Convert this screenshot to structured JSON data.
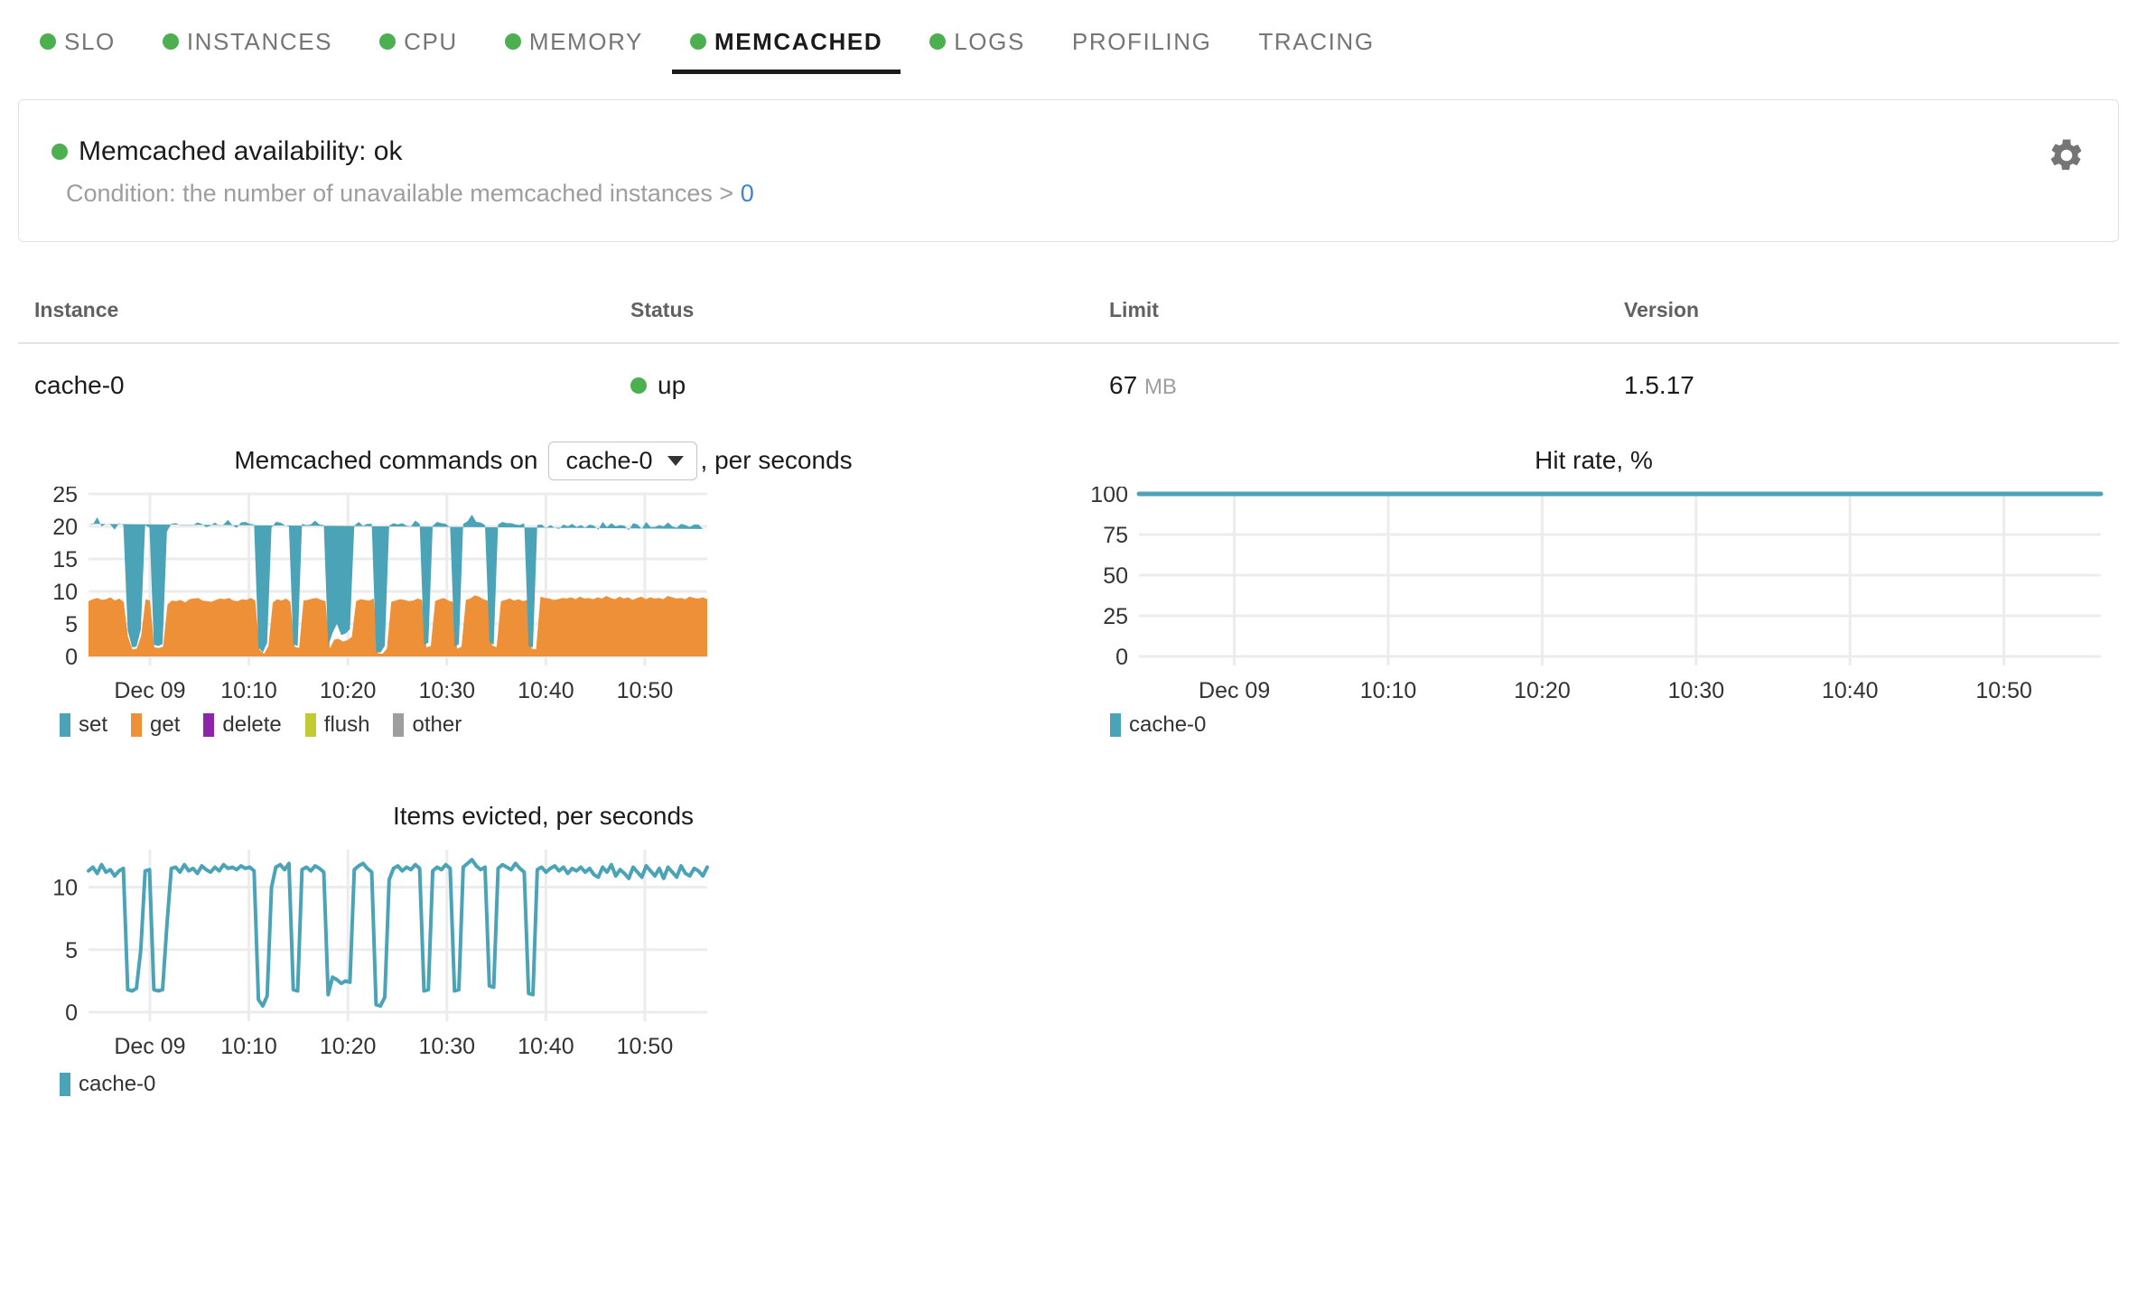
{
  "tabs": [
    {
      "label": "SLO",
      "dot": true,
      "active": false
    },
    {
      "label": "INSTANCES",
      "dot": true,
      "active": false
    },
    {
      "label": "CPU",
      "dot": true,
      "active": false
    },
    {
      "label": "MEMORY",
      "dot": true,
      "active": false
    },
    {
      "label": "MEMCACHED",
      "dot": true,
      "active": true
    },
    {
      "label": "LOGS",
      "dot": true,
      "active": false
    },
    {
      "label": "PROFILING",
      "dot": false,
      "active": false
    },
    {
      "label": "TRACING",
      "dot": false,
      "active": false
    }
  ],
  "availability": {
    "title": "Memcached availability: ok",
    "condition_prefix": "Condition: the number of unavailable memcached instances >",
    "condition_value": "0",
    "gear_icon": "gear-icon",
    "status_color": "#4caf50"
  },
  "table": {
    "headers": [
      "Instance",
      "Status",
      "Limit",
      "Version"
    ],
    "rows": [
      {
        "instance": "cache-0",
        "status": "up",
        "status_color": "#4caf50",
        "limit_value": "67",
        "limit_unit": "MB",
        "version": "1.5.17"
      }
    ]
  },
  "colors": {
    "set": "#4BA3B8",
    "get": "#EE9037",
    "delete": "#8E24AA",
    "flush": "#C0CA33",
    "other": "#9E9E9E",
    "grid": "#ececec",
    "axis_text": "#333333"
  },
  "chart_data": [
    {
      "type": "area",
      "id": "memcached-commands",
      "title_prefix": "Memcached commands on",
      "title_suffix": ", per seconds",
      "instance_select": {
        "value": "cache-0",
        "options": [
          "cache-0"
        ]
      },
      "xlabel": "",
      "ylabel": "",
      "ylim": [
        0,
        25
      ],
      "yticks": [
        0,
        5,
        10,
        15,
        20,
        25
      ],
      "xticks": [
        "Dec 09",
        "10:10",
        "10:20",
        "10:30",
        "10:40",
        "10:50"
      ],
      "grid": true,
      "stacked": true,
      "legend": [
        "set",
        "get",
        "delete",
        "flush",
        "other"
      ],
      "legend_position": "bottom-left",
      "series": [
        {
          "name": "get",
          "color": "#EE9037",
          "values": [
            8.5,
            8.8,
            9.0,
            8.7,
            8.8,
            9.1,
            8.6,
            8.9,
            8.4,
            3.0,
            1.1,
            1.2,
            3.2,
            8.8,
            8.6,
            1.4,
            1.3,
            1.5,
            8.0,
            8.6,
            8.5,
            8.7,
            8.3,
            8.8,
            8.9,
            9.0,
            8.6,
            8.5,
            8.4,
            8.7,
            8.9,
            8.8,
            9.0,
            8.6,
            8.5,
            8.8,
            8.7,
            9.0,
            8.6,
            1.0,
            0.4,
            1.6,
            8.3,
            8.8,
            8.6,
            8.9,
            8.4,
            1.5,
            1.3,
            8.6,
            8.7,
            8.9,
            9.0,
            8.7,
            8.5,
            1.2,
            2.6,
            2.7,
            2.3,
            2.5,
            3.0,
            8.5,
            8.8,
            8.7,
            8.6,
            8.9,
            0.5,
            0.4,
            1.2,
            8.4,
            8.6,
            8.8,
            8.7,
            8.5,
            8.6,
            8.9,
            8.7,
            1.4,
            1.6,
            8.5,
            8.8,
            9.0,
            8.6,
            8.4,
            1.2,
            1.5,
            8.7,
            8.9,
            9.4,
            9.2,
            8.8,
            8.6,
            1.7,
            1.4,
            8.5,
            8.7,
            8.9,
            8.6,
            8.8,
            8.5,
            8.7,
            1.2,
            1.1,
            9.2,
            9.0,
            8.9,
            8.7,
            8.8,
            9.0,
            8.9,
            9.1,
            8.8,
            9.2,
            8.9,
            9.0,
            8.8,
            9.1,
            8.9,
            9.3,
            9.0,
            8.8,
            9.2,
            8.9,
            9.1,
            8.7,
            9.0,
            9.2,
            8.8,
            9.1,
            8.9,
            9.0,
            8.8,
            9.3,
            9.1,
            8.9,
            9.0,
            8.8,
            9.2,
            9.0,
            8.9,
            9.1,
            8.8
          ]
        },
        {
          "name": "set",
          "color": "#4BA3B8",
          "values": [
            11.9,
            11.5,
            12.4,
            11.3,
            11.6,
            11.2,
            10.9,
            11.6,
            11.8,
            1.0,
            0.3,
            0.3,
            0.9,
            11.4,
            11.2,
            0.4,
            0.3,
            0.4,
            11.2,
            11.8,
            12.0,
            11.5,
            11.9,
            11.4,
            11.3,
            11.6,
            11.8,
            11.4,
            11.7,
            11.9,
            11.2,
            11.5,
            12.0,
            11.6,
            11.3,
            11.8,
            12.0,
            11.4,
            11.7,
            0.4,
            0.2,
            0.5,
            11.5,
            11.9,
            12.0,
            11.3,
            11.6,
            0.4,
            0.3,
            11.8,
            11.5,
            11.4,
            11.9,
            11.6,
            11.7,
            0.4,
            1.0,
            2.3,
            1.0,
            1.0,
            1.2,
            11.6,
            11.9,
            11.4,
            11.8,
            11.5,
            0.2,
            0.2,
            0.4,
            11.7,
            11.9,
            11.5,
            11.8,
            11.6,
            11.4,
            12.0,
            11.7,
            0.4,
            0.5,
            11.6,
            11.9,
            11.5,
            11.8,
            11.4,
            0.3,
            0.4,
            11.7,
            11.9,
            12.4,
            11.5,
            11.8,
            11.6,
            0.5,
            0.4,
            11.8,
            12.0,
            11.6,
            11.9,
            11.5,
            11.7,
            11.8,
            0.4,
            0.3,
            11.0,
            11.3,
            10.8,
            11.5,
            11.0,
            10.6,
            11.4,
            10.9,
            11.6,
            10.7,
            11.3,
            10.8,
            11.5,
            11.0,
            10.6,
            11.4,
            10.9,
            11.7,
            10.8,
            11.3,
            11.0,
            10.7,
            11.5,
            11.1,
            10.8,
            11.6,
            11.0,
            10.9,
            11.4,
            10.7,
            11.5,
            11.1,
            10.8,
            11.6,
            11.0,
            10.9,
            11.4,
            11.2,
            10.8,
            11.9
          ]
        },
        {
          "name": "delete",
          "color": "#8E24AA",
          "values": []
        },
        {
          "name": "flush",
          "color": "#C0CA33",
          "values": []
        },
        {
          "name": "other",
          "color": "#9E9E9E",
          "values": []
        }
      ]
    },
    {
      "type": "line",
      "id": "hit-rate",
      "title": "Hit rate, %",
      "xlabel": "",
      "ylabel": "",
      "ylim": [
        0,
        100
      ],
      "yticks": [
        0,
        25,
        50,
        75,
        100
      ],
      "xticks": [
        "Dec 09",
        "10:10",
        "10:20",
        "10:30",
        "10:40",
        "10:50"
      ],
      "grid": true,
      "legend": [
        "cache-0"
      ],
      "legend_position": "bottom-left",
      "series": [
        {
          "name": "cache-0",
          "color": "#4BA3B8",
          "values": [
            100,
            100,
            100,
            100,
            100,
            100,
            100,
            100,
            100,
            100,
            100,
            100,
            100,
            100,
            100,
            100,
            100,
            100,
            100,
            100,
            100,
            100,
            100,
            100,
            100,
            100,
            100,
            100,
            100,
            100,
            100,
            100,
            100,
            100,
            100,
            100,
            100,
            100,
            100,
            100
          ]
        }
      ]
    },
    {
      "type": "line",
      "id": "items-evicted",
      "title": "Items evicted, per seconds",
      "xlabel": "",
      "ylabel": "",
      "ylim": [
        0,
        13
      ],
      "yticks": [
        0,
        5,
        10
      ],
      "xticks": [
        "Dec 09",
        "10:10",
        "10:20",
        "10:30",
        "10:40",
        "10:50"
      ],
      "grid": true,
      "legend": [
        "cache-0"
      ],
      "legend_position": "bottom-left",
      "series": [
        {
          "name": "cache-0",
          "color": "#4BA3B8",
          "values": [
            11.3,
            11.6,
            11.1,
            11.8,
            11.2,
            11.4,
            10.9,
            11.3,
            11.5,
            1.8,
            1.7,
            1.9,
            5.0,
            11.3,
            11.4,
            1.8,
            1.7,
            1.8,
            7.0,
            11.5,
            11.6,
            11.2,
            11.8,
            11.3,
            11.5,
            11.1,
            11.7,
            11.4,
            11.2,
            11.6,
            11.3,
            11.8,
            11.5,
            11.6,
            11.4,
            11.7,
            11.5,
            11.6,
            11.3,
            1.0,
            0.5,
            1.3,
            10.0,
            11.6,
            11.8,
            11.4,
            11.9,
            1.8,
            1.7,
            11.4,
            11.6,
            11.3,
            11.7,
            11.5,
            11.2,
            1.4,
            2.8,
            2.6,
            2.3,
            2.5,
            2.4,
            11.4,
            11.7,
            11.9,
            11.5,
            11.2,
            0.6,
            0.5,
            1.2,
            10.6,
            11.5,
            11.7,
            11.3,
            11.6,
            11.4,
            11.8,
            11.5,
            1.7,
            1.8,
            11.3,
            11.6,
            11.4,
            11.8,
            11.5,
            1.7,
            1.8,
            11.6,
            11.9,
            12.2,
            11.7,
            11.4,
            11.6,
            2.1,
            2.0,
            11.5,
            11.8,
            11.6,
            11.4,
            11.9,
            11.5,
            11.2,
            1.5,
            1.4,
            11.4,
            11.6,
            11.2,
            11.5,
            11.7,
            11.3,
            11.6,
            11.1,
            11.5,
            11.3,
            11.6,
            11.2,
            11.5,
            11.0,
            10.8,
            11.6,
            11.2,
            11.8,
            10.9,
            11.4,
            11.1,
            10.7,
            11.6,
            11.2,
            10.8,
            11.7,
            11.3,
            10.9,
            11.5,
            10.7,
            11.6,
            11.2,
            10.8,
            11.7,
            11.1,
            10.9,
            11.5,
            11.3,
            10.9,
            11.6
          ]
        }
      ]
    }
  ]
}
